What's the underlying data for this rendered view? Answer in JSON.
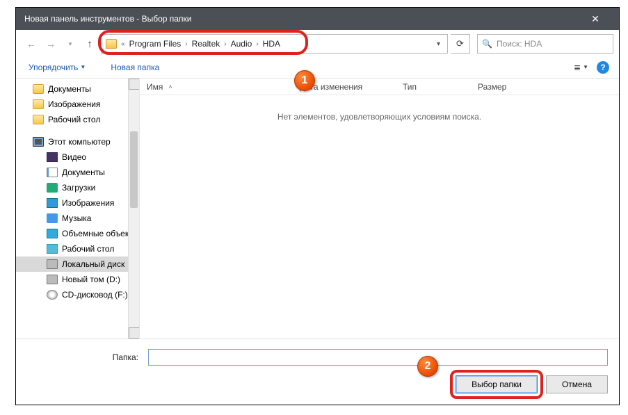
{
  "window": {
    "title": "Новая панель инструментов - Выбор папки"
  },
  "address": {
    "crumbs": [
      "Program Files",
      "Realtek",
      "Audio",
      "HDA"
    ]
  },
  "search": {
    "placeholder": "Поиск: HDA"
  },
  "toolbar": {
    "organize": "Упорядочить",
    "newfolder": "Новая папка"
  },
  "tree": {
    "items": [
      {
        "label": "Документы",
        "icon": "folder",
        "lvl": 1
      },
      {
        "label": "Изображения",
        "icon": "folder",
        "lvl": 1
      },
      {
        "label": "Рабочий стол",
        "icon": "folder",
        "lvl": 1
      },
      {
        "label": "",
        "icon": "",
        "lvl": 1
      },
      {
        "label": "Этот компьютер",
        "icon": "pc",
        "lvl": 0
      },
      {
        "label": "Видео",
        "icon": "video",
        "lvl": 2
      },
      {
        "label": "Документы",
        "icon": "doc",
        "lvl": 2
      },
      {
        "label": "Загрузки",
        "icon": "dl",
        "lvl": 2
      },
      {
        "label": "Изображения",
        "icon": "img",
        "lvl": 2
      },
      {
        "label": "Музыка",
        "icon": "music",
        "lvl": 2
      },
      {
        "label": "Объемные объекты",
        "icon": "vol",
        "lvl": 2
      },
      {
        "label": "Рабочий стол",
        "icon": "desk",
        "lvl": 2
      },
      {
        "label": "Локальный диск",
        "icon": "disk",
        "lvl": 2,
        "sel": true
      },
      {
        "label": "Новый том (D:)",
        "icon": "disk",
        "lvl": 2
      },
      {
        "label": "CD-дисковод (F:)",
        "icon": "cd",
        "lvl": 2
      }
    ]
  },
  "columns": {
    "name": "Имя",
    "date": "Дата изменения",
    "type": "Тип",
    "size": "Размер"
  },
  "list": {
    "empty": "Нет элементов, удовлетворяющих условиям поиска."
  },
  "footer": {
    "folder_label": "Папка:",
    "folder_value": "",
    "select": "Выбор папки",
    "cancel": "Отмена"
  },
  "callouts": {
    "c1": "1",
    "c2": "2"
  }
}
